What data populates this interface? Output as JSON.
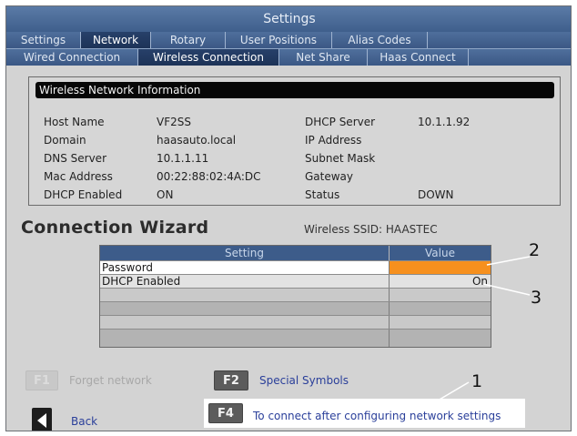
{
  "window": {
    "title": "Settings"
  },
  "tabs_main": [
    "Settings",
    "Network",
    "Rotary",
    "User Positions",
    "Alias Codes"
  ],
  "tabs_main_active": "Network",
  "tabs_sub": [
    "Wired Connection",
    "Wireless Connection",
    "Net Share",
    "Haas Connect"
  ],
  "tabs_sub_active": "Wireless Connection",
  "info": {
    "header": "Wireless Network Information",
    "host_name_label": "Host Name",
    "host_name": "VF2SS",
    "domain_label": "Domain",
    "domain": "haasauto.local",
    "dns_label": "DNS Server",
    "dns": "10.1.1.11",
    "mac_label": "Mac Address",
    "mac": "00:22:88:02:4A:DC",
    "dhcp_enabled_label": "DHCP Enabled",
    "dhcp_enabled": "ON",
    "dhcp_server_label": "DHCP Server",
    "dhcp_server": "10.1.1.92",
    "ip_label": "IP Address",
    "ip": "",
    "subnet_label": "Subnet Mask",
    "subnet": "",
    "gateway_label": "Gateway",
    "gateway": "",
    "status_label": "Status",
    "status": "DOWN"
  },
  "wizard": {
    "title": "Connection Wizard",
    "ssid": "Wireless SSID: HAASTEC",
    "col_setting": "Setting",
    "col_value": "Value",
    "rows": [
      {
        "setting": "Password",
        "value": ""
      },
      {
        "setting": "DHCP Enabled",
        "value": "On"
      }
    ]
  },
  "keys": {
    "f1": "F1",
    "f1_hint": "Forget network",
    "f2": "F2",
    "f2_hint": "Special Symbols",
    "back_hint": "Back",
    "f4": "F4",
    "f4_hint": "To connect after configuring network settings"
  },
  "callouts": {
    "c1": "1",
    "c2": "2",
    "c3": "3"
  },
  "colors": {
    "title_bar": "#4a6a98",
    "active_tab": "#27406a",
    "password_value_cell": "#f6901e",
    "hint_text": "#2a3f9a"
  },
  "icons": {
    "back": "arrow-left-icon"
  }
}
